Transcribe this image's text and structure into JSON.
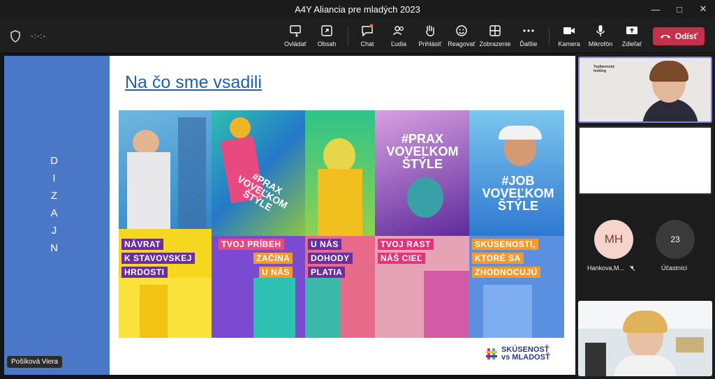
{
  "window": {
    "title": "A4Y Aliancia pre mladých 2023"
  },
  "meeting": {
    "timer": "-:-:-"
  },
  "toolbar": {
    "control": "Ovládať",
    "share": "Obsah",
    "chat": "Chat",
    "people": "Ľudia",
    "raise": "Prihlásiť",
    "react": "Reagovať",
    "view": "Zobrazenie",
    "more": "Ďalšie",
    "camera": "Kamera",
    "mic": "Mikrofón",
    "share_screen": "Zdieľať",
    "leave": "Odísť"
  },
  "slide": {
    "title": "Na čo sme vsadili",
    "side_letters": [
      "D",
      "I",
      "Z",
      "A",
      "J",
      "N"
    ],
    "panels": [
      {
        "tags": [
          "NÁVRAT",
          "K STAVOVSKEJ",
          "HRDOSTI"
        ]
      },
      {
        "hashtag": "#PRAX\nVOVEĽKOM\nŠTÝLE",
        "tags": [
          "TVOJ PRÍBEH",
          "ZAČÍNA",
          "U NÁS"
        ]
      },
      {
        "tags": [
          "U NÁS",
          "DOHODY",
          "PLATIA"
        ]
      },
      {
        "hashtag": "#PRAX\nVOVEĽKOM\nŠTÝLE",
        "tags": [
          "TVOJ RAST",
          "NÁŠ CIEĽ"
        ]
      },
      {
        "hashtag": "#JOB\nVOVEĽKOM\nŠTÝLE",
        "tags": [
          "SKÚSENOSTI,",
          "KTORÉ SA",
          "ZHODNOCUJÚ"
        ]
      }
    ],
    "brand_line1": "SKÚSENOSŤ",
    "brand_line2": "vs MLADOSŤ"
  },
  "presenter_name": "Pošíková Viera",
  "participants": {
    "tile1_logo": "Tepllárenský holding",
    "avatar_initials": "MH",
    "avatar_name": "Hankova,M...",
    "overflow_count": "23",
    "overflow_label": "Účastníci"
  },
  "colors": {
    "accent": "#7b83eb",
    "leave": "#c4314b",
    "slide_bar": "#4a78c7",
    "title": "#1f5fae"
  }
}
